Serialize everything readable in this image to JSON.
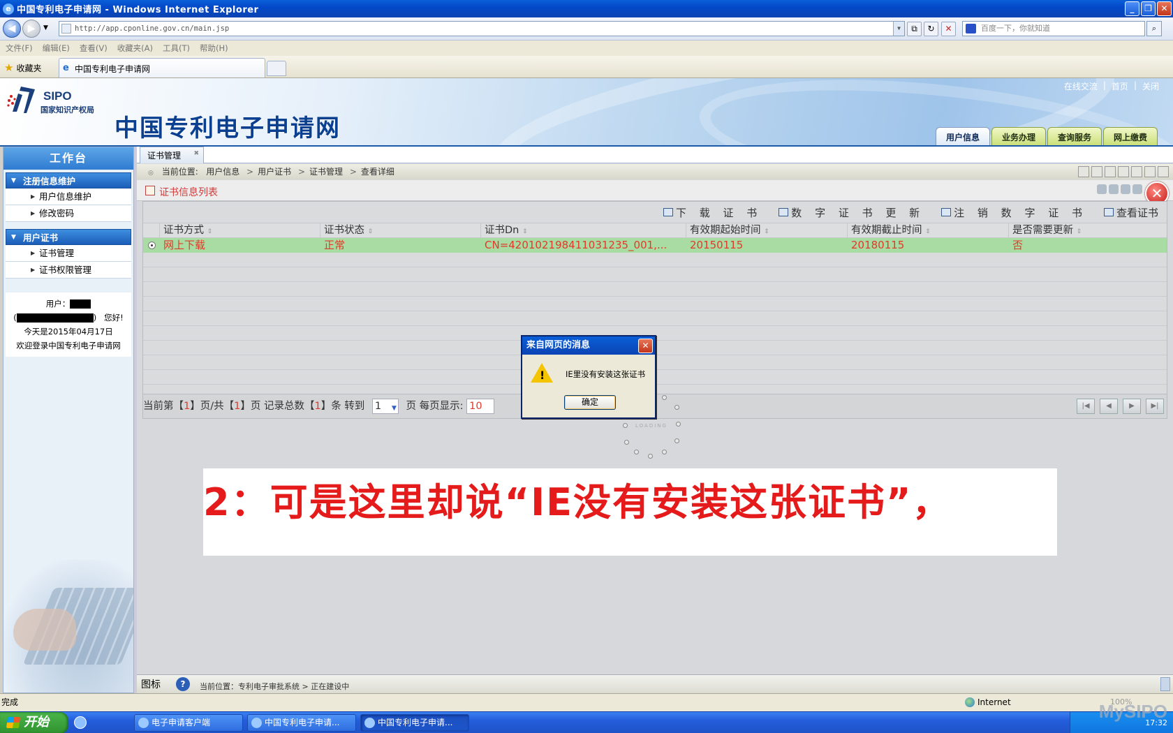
{
  "window": {
    "title": "中国专利电子申请网 - Windows Internet Explorer"
  },
  "browser": {
    "address": "http://app.cponline.gov.cn/main.jsp",
    "search_placeholder": "百度一下，你就知道",
    "menu": [
      "文件(F)",
      "编辑(E)",
      "查看(V)",
      "收藏夹(A)",
      "工具(T)",
      "帮助(H)"
    ],
    "favorites_label": "收藏夹",
    "tab_title": "中国专利电子申请网"
  },
  "site": {
    "logo_text": "SIPO",
    "logo_sub": "国家知识产权局",
    "title": "中国专利电子申请网",
    "top_links": [
      "在线交流",
      "|",
      "首页",
      "|",
      "关闭"
    ],
    "main_tabs": [
      "用户信息",
      "业务办理",
      "查询服务",
      "网上缴费"
    ]
  },
  "sidebar": {
    "header": "工作台",
    "groups": [
      {
        "label": "注册信息维护",
        "items": [
          "用户信息维护",
          "修改密码"
        ]
      },
      {
        "label": "用户证书",
        "items": [
          "证书管理",
          "证书权限管理"
        ]
      }
    ],
    "user": {
      "user_label": "用户：",
      "greeting": "您好!",
      "date_line": "今天是2015年04月17日",
      "welcome": "欢迎登录中国专利电子申请网"
    }
  },
  "content": {
    "tab": "证书管理",
    "breadcrumb": {
      "prefix": "当前位置:",
      "parts": [
        "用户信息",
        "用户证书",
        "证书管理",
        "查看详细"
      ]
    },
    "section_title": "证书信息列表",
    "actions": [
      "下 载 证 书",
      "数 字 证 书 更 新",
      "注 销 数 字 证 书",
      "查看证书"
    ],
    "columns": [
      "证书方式",
      "证书状态",
      "证书Dn",
      "有效期起始时间",
      "有效期截止时间",
      "是否需要更新"
    ],
    "rows": [
      [
        "网上下载",
        "正常",
        "CN=420102198411031235_001,...",
        "20150115",
        "20180115",
        "否"
      ]
    ],
    "pager": {
      "p1": "当前第【",
      "cur": "1",
      "p2": "】页/共【",
      "total": "1",
      "p3": "】页 记录总数【",
      "count": "1",
      "p4": "】条 转到",
      "goto": "1",
      "p5": "页 每页显示:",
      "per_page": "10"
    },
    "loading_text": "LOADING"
  },
  "dialog": {
    "title": "来自网页的消息",
    "message": "IE里没有安装这张证书",
    "ok": "确定"
  },
  "caption": "2：可是这里却说“IE没有安装这张证书”，",
  "bottom": {
    "label": "图标",
    "path": "当前位置：专利电子审批系统 > 正在建设中"
  },
  "status": {
    "text": "完成",
    "zone": "Internet",
    "zoom": "100%"
  },
  "taskbar": {
    "start": "开始",
    "buttons": [
      "电子申请客户端",
      "中国专利电子申请...",
      "中国专利电子申请..."
    ],
    "clock": "17:32"
  },
  "watermark": "MySIPO"
}
